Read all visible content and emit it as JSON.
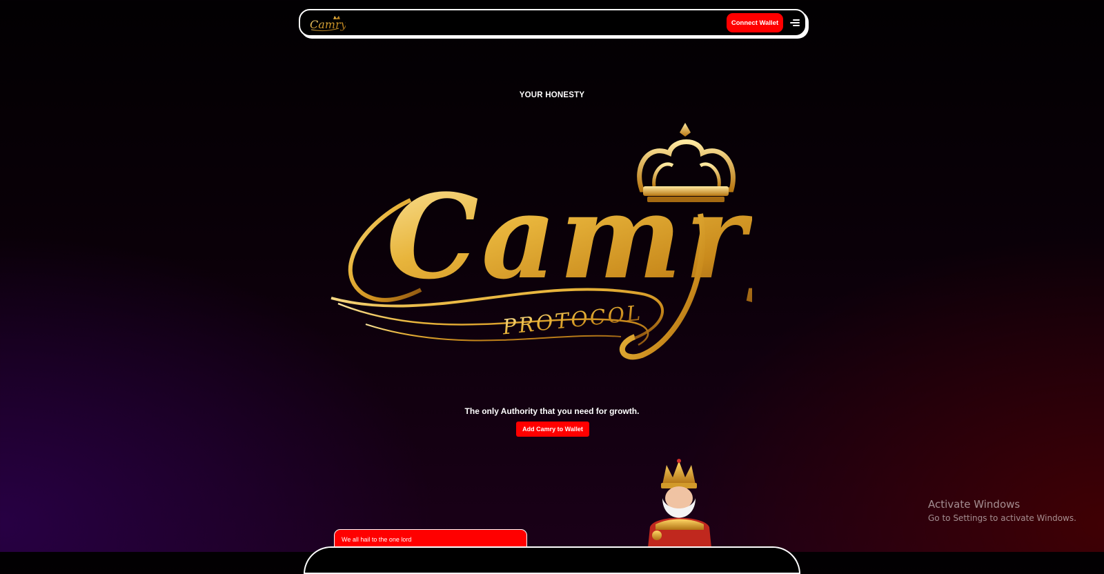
{
  "nav": {
    "logo_text": "Camry",
    "connect_label": "Connect Wallet"
  },
  "hero": {
    "tagline": "YOUR HONESTY",
    "logo_word": "Camry",
    "logo_sub": "PROTOCOL",
    "subtitle": "The only Authority that you need for growth.",
    "add_label": "Add Camry to Wallet"
  },
  "chat": {
    "bubble_text": "We all hail to the one lord"
  },
  "os": {
    "watermark_title": "Activate Windows",
    "watermark_sub": "Go to Settings to activate Windows."
  },
  "colors": {
    "accent": "#ff0000",
    "gold": "#e8b53c",
    "background": "#050005"
  },
  "icons": [
    "crown-icon",
    "menu-icon"
  ]
}
